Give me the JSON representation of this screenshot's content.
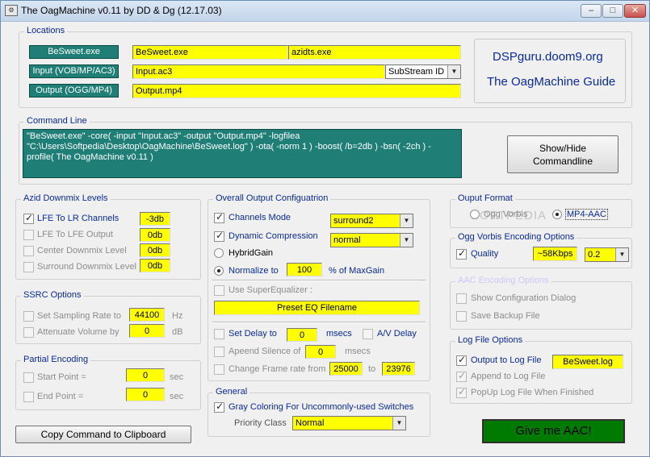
{
  "window": {
    "title": "The OagMachine v0.11 by DD & Dg (12.17.03)",
    "minimize": "–",
    "maximize": "□",
    "close": "✕"
  },
  "locations": {
    "legend": "Locations",
    "besweet_label": "BeSweet.exe",
    "besweet_value": "BeSweet.exe",
    "azidts_value": "azidts.exe",
    "input_label": "Input (VOB/MP/AC3)",
    "input_value": "Input.ac3",
    "substream_value": "SubStream ID",
    "output_label": "Output (OGG/MP4)",
    "output_value": "Output.mp4",
    "link1": "DSPguru.doom9.org",
    "link2": "The OagMachine Guide"
  },
  "command_line": {
    "legend": "Command Line",
    "text": "\"BeSweet.exe\" -core( -input \"Input.ac3\" -output \"Output.mp4\" -logfilea \"C:\\Users\\Softpedia\\Desktop\\OagMachine\\BeSweet.log\" ) -ota( -norm 1 ) -boost( /b=2db ) -bsn( -2ch ) -profile( The OagMachine v0.11 )",
    "show_hide": "Show/Hide\nCommandline"
  },
  "azid": {
    "legend": "Azid Downmix Levels",
    "items": [
      {
        "label": "LFE To LR Channels",
        "value": "-3db"
      },
      {
        "label": "LFE To LFE Output",
        "value": "0db"
      },
      {
        "label": "Center Downmix Level",
        "value": "0db"
      },
      {
        "label": "Surround Downmix Level",
        "value": "0db"
      }
    ]
  },
  "ssrc": {
    "legend": "SSRC Options",
    "rate_label": "Set Sampling Rate to",
    "rate_value": "44100",
    "rate_unit": "Hz",
    "atten_label": "Attenuate Volume by",
    "atten_value": "0",
    "atten_unit": "dB"
  },
  "partial": {
    "legend": "Partial Encoding",
    "start_label": "Start Point =",
    "start_value": "0",
    "start_unit": "sec",
    "end_label": "End Point  =",
    "end_value": "0",
    "end_unit": "sec"
  },
  "copy_button": "Copy Command to Clipboard",
  "overall": {
    "legend": "Overall Output Configuatrion",
    "channels_label": "Channels Mode",
    "channels_value": "surround2",
    "dyn_label": "Dynamic Compression",
    "dyn_value": "normal",
    "hybrid_label": "HybridGain",
    "normalize_label": "Normalize to",
    "normalize_value": "100",
    "normalize_unit": "% of MaxGain",
    "supereq_label": "Use SuperEqualizer :",
    "preset_value": "Preset EQ Filename",
    "delay_label": "Set Delay to",
    "delay_value": "0",
    "delay_unit": "msecs",
    "av_delay_label": "A/V Delay",
    "append_label": "Apeend Silence of",
    "append_value": "0",
    "append_unit": "msecs",
    "frame_label": "Change Frame rate from",
    "frame_from": "25000",
    "frame_to_label": "to",
    "frame_to": "23976"
  },
  "general": {
    "legend": "General",
    "gray_label": "Gray Coloring For Uncommonly-used Switches",
    "priority_label": "Priority Class",
    "priority_value": "Normal"
  },
  "output_format": {
    "legend": "Ouput Format",
    "ogg_label": "Ogg Vorbis",
    "mp4_label": "MP4-AAC",
    "watermark": "SOFTPEDIA"
  },
  "ogg_opts": {
    "legend": "Ogg Vorbis Encoding Options",
    "quality_label": "Quality",
    "kbps_value": "~58Kbps",
    "quality_value": "0.2"
  },
  "aac_opts": {
    "legend": "AAC Encoding Options",
    "config_label": "Show Configuration Dialog",
    "backup_label": "Save Backup File"
  },
  "logfile": {
    "legend": "Log File Options",
    "output_label": "Output to Log File",
    "output_value": "BeSweet.log",
    "append_label": "Append to Log File",
    "popup_label": "PopUp Log File When Finished"
  },
  "go_button": "Give me AAC!"
}
